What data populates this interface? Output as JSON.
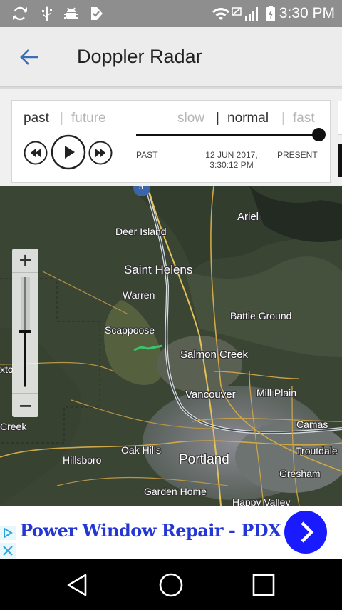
{
  "status_bar": {
    "time": "3:30 PM",
    "left_icons": [
      "sync-icon",
      "usb-icon",
      "android-debug-icon",
      "task-check-icon"
    ],
    "right_icons": [
      "wifi-icon",
      "no-sim-icon",
      "signal-icon",
      "battery-charging-icon"
    ]
  },
  "app_bar": {
    "title": "Doppler Radar",
    "back_icon": "arrow-back-icon"
  },
  "controls": {
    "mode_past": "past",
    "mode_separator": "|",
    "mode_future": "future",
    "speed_slow": "slow",
    "speed_sep1": "|",
    "speed_normal": "normal",
    "speed_sep2": "|",
    "speed_fast": "fast",
    "active_mode": "past",
    "active_speed": "normal",
    "buttons": [
      "rewind-icon",
      "play-icon",
      "fast-forward-icon"
    ],
    "timeline_progress": 1.0,
    "timeline_left": "PAST",
    "timeline_center_date": "12 JUN 2017,",
    "timeline_center_time": "3:30:12 PM",
    "timeline_right": "PRESENT"
  },
  "map": {
    "zoom_in": "+",
    "zoom_out": "−",
    "places": {
      "ariel": "Ariel",
      "deer_island": "Deer Island",
      "saint_helens": "Saint Helens",
      "warren": "Warren",
      "battle_ground": "Battle Ground",
      "scappoose": "Scappoose",
      "salmon_creek": "Salmon Creek",
      "vancouver": "Vancouver",
      "mill_plain": "Mill Plain",
      "camas": "Camas",
      "creek": "Creek",
      "oak_hills": "Oak Hills",
      "hillsboro": "Hillsboro",
      "portland": "Portland",
      "troutdale": "Troutdale",
      "gresham": "Gresham",
      "garden_home": "Garden Home",
      "happy_valley": "Happy Valley",
      "xto": "xto"
    },
    "route_shield": "5"
  },
  "ad": {
    "title": "Power Window Repair - PDX",
    "cta_icon": "chevron-right-icon",
    "adchoices_icon": "adchoices-icon",
    "close_icon": "close-icon"
  },
  "nav_bar": {
    "back": "nav-back-icon",
    "home": "nav-home-icon",
    "recents": "nav-recents-icon"
  },
  "colors": {
    "status_bar": "#8e8e8e",
    "app_bar": "#ececec",
    "accent": "#3a6fb0",
    "ad_title": "#2436d6",
    "ad_cta": "#1a1aff"
  }
}
